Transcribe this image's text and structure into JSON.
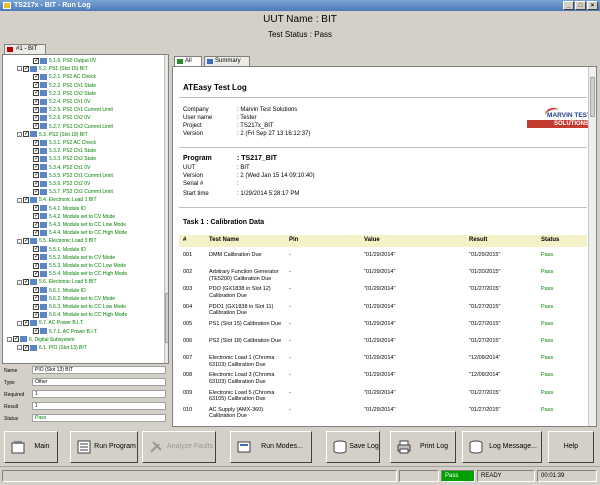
{
  "window": {
    "title": "TS217x - BIT - Run Log",
    "buttons": [
      "_",
      "□",
      "×"
    ]
  },
  "header": {
    "uut_name": "UUT Name : BIT",
    "test_status": "Test Status : Pass"
  },
  "left_tab": {
    "label": "#1 - BIT"
  },
  "tree": {
    "items": [
      {
        "label": "5.1.6. PS0 Output 0V",
        "level": 3
      },
      {
        "label": "5.2. PS1 (Slot 15) BIT",
        "level": 2
      },
      {
        "label": "5.2.1. PS1 AC Check",
        "level": 3
      },
      {
        "label": "5.2.2. PS1 Ch1 State",
        "level": 3
      },
      {
        "label": "5.2.3. PS1 Ch2 State",
        "level": 3
      },
      {
        "label": "5.2.4. PS1 Ch1 0V",
        "level": 3
      },
      {
        "label": "5.2.5. PS1 Ch1 Current Limit",
        "level": 3
      },
      {
        "label": "5.2.6. PS1 Ch2 0V",
        "level": 3
      },
      {
        "label": "5.2.7. PS1 Ch2 Current Limit",
        "level": 3
      },
      {
        "label": "5.3. PS2 (Slot 18) BIT",
        "level": 2
      },
      {
        "label": "5.3.1. PS2 AC Check",
        "level": 3
      },
      {
        "label": "5.3.2. PS2 Ch1 State",
        "level": 3
      },
      {
        "label": "5.3.3. PS2 Ch2 State",
        "level": 3
      },
      {
        "label": "5.3.4. PS2 Ch1 0V",
        "level": 3
      },
      {
        "label": "5.3.5. PS2 Ch1 Current Limit",
        "level": 3
      },
      {
        "label": "5.3.6. PS2 Ch2 0V",
        "level": 3
      },
      {
        "label": "5.3.7. PS2 Ch2 Current Limit",
        "level": 3
      },
      {
        "label": "5.4. Electronic Load 1 BIT",
        "level": 2
      },
      {
        "label": "5.4.1. Module ID",
        "level": 3
      },
      {
        "label": "5.4.2. Module set to CV Mode",
        "level": 3
      },
      {
        "label": "5.4.3. Module set to CC Low Mode",
        "level": 3
      },
      {
        "label": "5.4.4. Module set to CC High Mode",
        "level": 3
      },
      {
        "label": "5.5. Electronic Load 3 BIT",
        "level": 2
      },
      {
        "label": "5.5.1. Module ID",
        "level": 3
      },
      {
        "label": "5.5.2. Module set to CV Mode",
        "level": 3
      },
      {
        "label": "5.5.3. Module set to CC Low Mode",
        "level": 3
      },
      {
        "label": "5.5.4. Module set to CC High Mode",
        "level": 3
      },
      {
        "label": "5.6. Electronic Load 5 BIT",
        "level": 2
      },
      {
        "label": "5.6.1. Module ID",
        "level": 3
      },
      {
        "label": "5.6.2. Module set to CV Mode",
        "level": 3
      },
      {
        "label": "5.6.3. Module set to CC Low Mode",
        "level": 3
      },
      {
        "label": "5.6.4. Module set to CC High Mode",
        "level": 3
      },
      {
        "label": "5.7. AC Power B.I.T.",
        "level": 2
      },
      {
        "label": "5.7.1. AC Power B.I.T.",
        "level": 3
      },
      {
        "label": "6. Digital Subsystem",
        "level": 1
      },
      {
        "label": "6.1. PIO (Slot 13) BIT",
        "level": 2
      }
    ]
  },
  "props": {
    "rows": [
      {
        "label": "Name",
        "value": "PIO (Slot 13) BIT"
      },
      {
        "label": "Type",
        "value": "Other"
      },
      {
        "label": "Required",
        "value": "1"
      },
      {
        "label": "Result",
        "value": "1"
      },
      {
        "label": "Status",
        "value": "Pass"
      }
    ]
  },
  "right_tabs": {
    "all": "All",
    "summary": "Summary"
  },
  "doc": {
    "title": "ATEasy Test Log",
    "company_label": "Company",
    "company_value": ": Marvin Test Solutions",
    "user_label": "User name",
    "user_value": ": Tester",
    "project_label": "Project",
    "project_value": ": TS217x_BIT",
    "version_label": "Version",
    "version_value": ": 2 (Fri Sep 27 13 16:12:37)",
    "logo_line1": "MARVIN TEST",
    "logo_line2": "SOLUTIONS",
    "program_label": "Program",
    "program_value": ": TS217_BIT",
    "uut_label": "UUT",
    "uut_value": ": BIT",
    "pversion_label": "Version",
    "pversion_value": ": 2 (Wed Jan 15 14 09:10:40)",
    "serial_label": "Serial #",
    "serial_value": ":",
    "start_label": "Start time",
    "start_value": ": 1/29/2014 5:28:17 PM",
    "task_title": "Task 1 : Calibration Data",
    "columns": [
      "#",
      "Test Name",
      "Pin",
      "Value",
      "Result",
      "Status"
    ],
    "rows": [
      {
        "num": "001",
        "name": "DMM Calibration Due",
        "pin": "-",
        "value": "\"01/29/2014\"",
        "result": "\"01/29/2015\"",
        "status": "Pass"
      },
      {
        "num": "002",
        "name": "Arbitrary Function Generator (TE5200) Calibration Due",
        "pin": "-",
        "value": "\"01/29/2014\"",
        "result": "\"01/20/2015\"",
        "status": "Pass"
      },
      {
        "num": "003",
        "name": "PDO (GX1838 in Slot 12) Calibration Due",
        "pin": "-",
        "value": "\"01/29/2014\"",
        "result": "\"01/27/2015\"",
        "status": "Pass"
      },
      {
        "num": "004",
        "name": "PDO1 (GX1838 in Slot 11) Calibration Due",
        "pin": "-",
        "value": "\"01/29/2014\"",
        "result": "\"01/27/2015\"",
        "status": "Pass"
      },
      {
        "num": "005",
        "name": "PS1 (Slot 15) Calibration Due",
        "pin": "-",
        "value": "\"01/29/2014\"",
        "result": "\"01/27/2015\"",
        "status": "Pass"
      },
      {
        "num": "006",
        "name": "PS2 (Slot 18) Calibration Due",
        "pin": "-",
        "value": "\"01/29/2014\"",
        "result": "\"01/27/2015\"",
        "status": "Pass"
      },
      {
        "num": "007",
        "name": "Electronic Load 1 (Chroma 63103) Calibration Due",
        "pin": "-",
        "value": "\"01/29/2014\"",
        "result": "\"12/09/2014\"",
        "status": "Pass"
      },
      {
        "num": "008",
        "name": "Electronic Load 3 (Chroma 63103) Calibration Due",
        "pin": "-",
        "value": "\"01/29/2014\"",
        "result": "\"12/09/2014\"",
        "status": "Pass"
      },
      {
        "num": "009",
        "name": "Electronic Load 5 (Chroma 63105) Calibration Due",
        "pin": "-",
        "value": "\"01/29/2014\"",
        "result": "\"01/27/2015\"",
        "status": "Pass"
      },
      {
        "num": "010",
        "name": "AC Supply (AMX-360) Calibration Due",
        "pin": "-",
        "value": "\"01/29/2014\"",
        "result": "\"01/27/2015\"",
        "status": "Pass"
      }
    ]
  },
  "toolbar": {
    "main": "Main",
    "run_program": "Run Program",
    "analyze_faults": "Analyze Faults",
    "run_modes": "Run Modes...",
    "save_log": "Save Log",
    "print_log": "Print Log",
    "log_message": "Log Message...",
    "help": "Help"
  },
  "status": {
    "pass": "Pass",
    "ready": "READY",
    "time": "00:01:39"
  },
  "colors": {
    "pass_green": "#008000",
    "title_blue": "#4d79b7",
    "header_yellow": "#f6f2c8"
  }
}
